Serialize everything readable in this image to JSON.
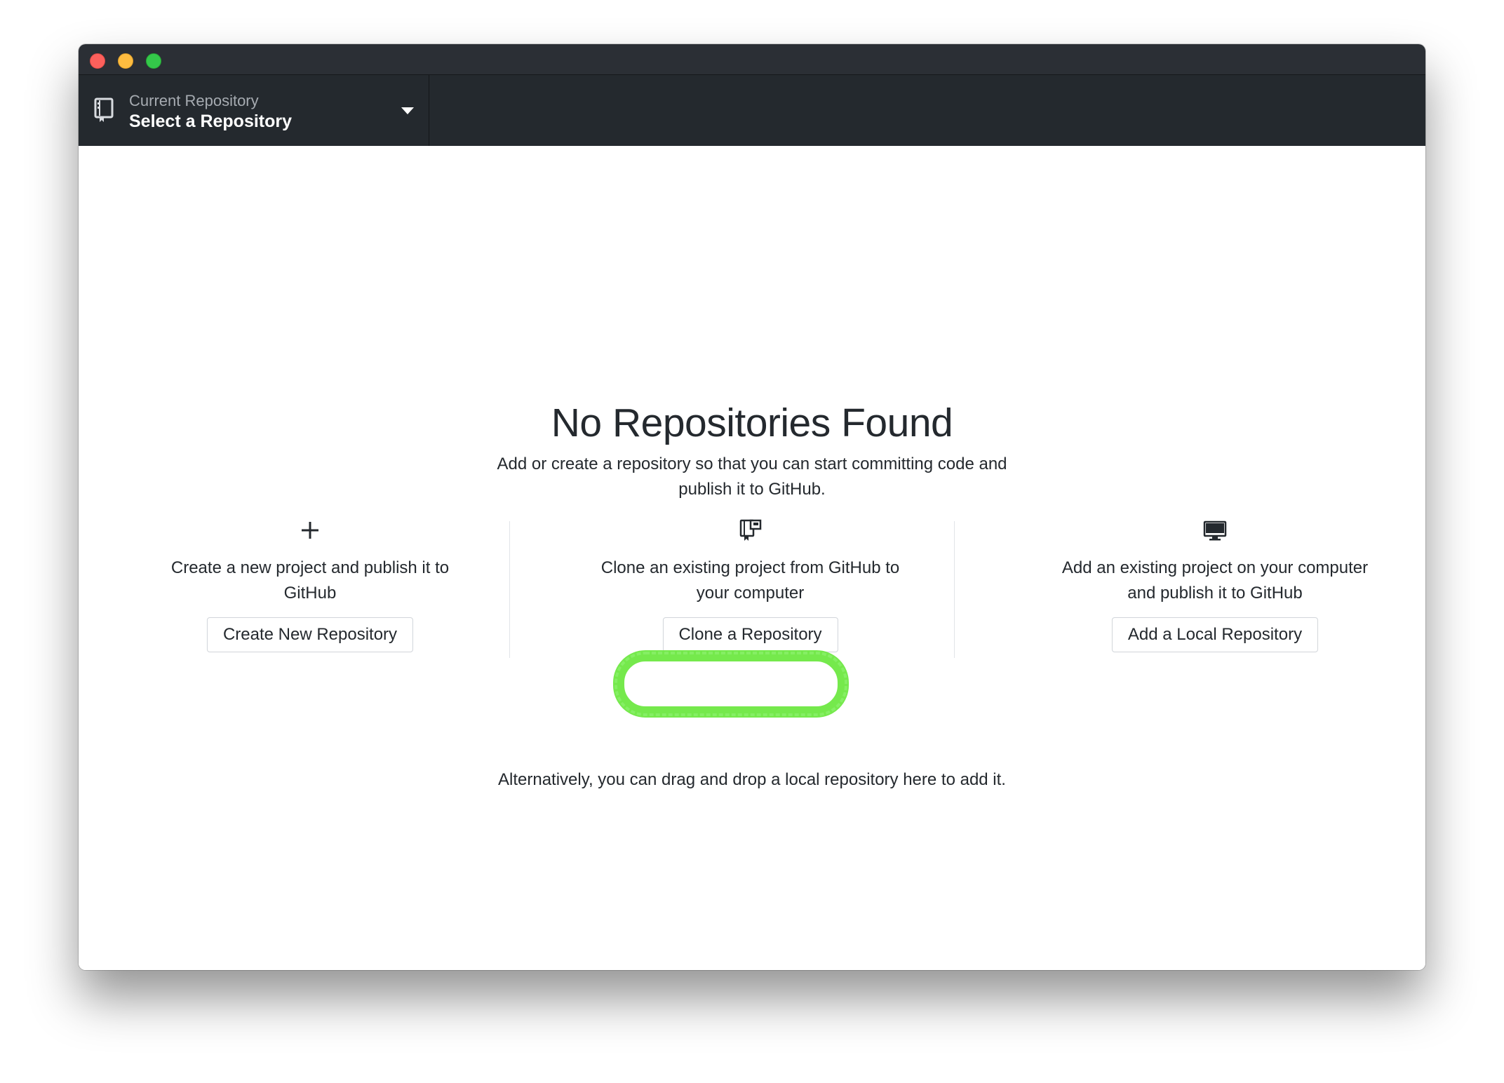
{
  "toolbar": {
    "repo_label": "Current Repository",
    "repo_value": "Select a Repository"
  },
  "main": {
    "title": "No Repositories Found",
    "subtitle": "Add or create a repository so that you can start committing code and publish it to GitHub.",
    "options": [
      {
        "icon": "plus-icon",
        "text": "Create a new project and publish it to GitHub",
        "button": "Create New Repository"
      },
      {
        "icon": "repo-clone-icon",
        "text": "Clone an existing project from GitHub to your computer",
        "button": "Clone a Repository"
      },
      {
        "icon": "monitor-icon",
        "text": "Add an existing project on your computer and publish it to GitHub",
        "button": "Add a Local Repository"
      }
    ],
    "footer": "Alternatively, you can drag and drop a local repository here to add it."
  },
  "colors": {
    "toolbar_bg": "#24292e",
    "text": "#24292e",
    "highlight": "#6ee842"
  }
}
